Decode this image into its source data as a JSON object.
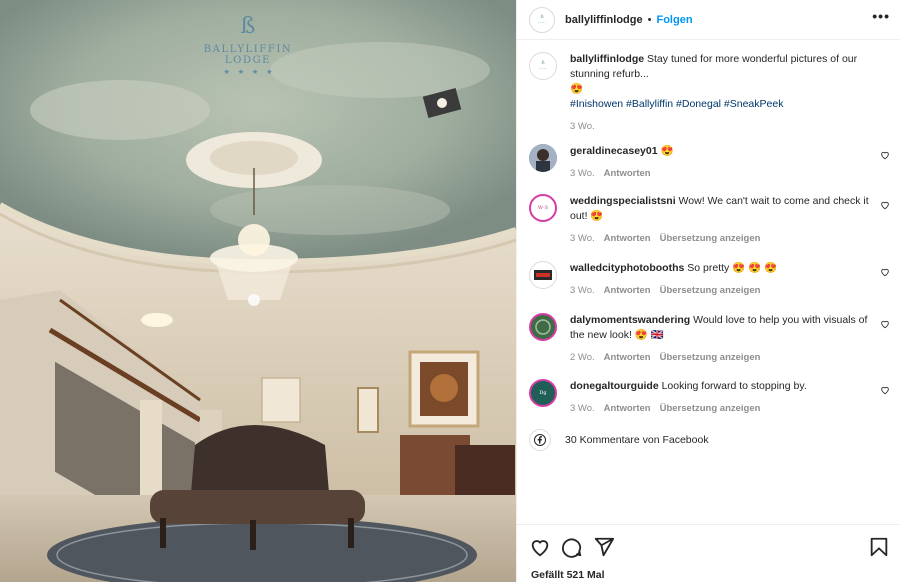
{
  "brand": {
    "mark": "ß",
    "name": "BALLYLIFFIN LODGE",
    "stars": "★★★★"
  },
  "header": {
    "username": "ballyliffinlodge",
    "separator": "•",
    "follow_label": "Folgen",
    "more_label": "•••"
  },
  "caption": {
    "username": "ballyliffinlodge",
    "text": "Stay tuned for more wonderful pictures of our stunning refurb...",
    "emoji": "😍",
    "hashtags": "#Inishowen #Ballyliffin #Donegal #SneakPeek",
    "time": "3 Wo."
  },
  "comments": [
    {
      "username": "geraldinecasey01",
      "text": "😍",
      "time": "3 Wo.",
      "reply": "Antworten",
      "translate": ""
    },
    {
      "username": "weddingspecialistsni",
      "text": "Wow! We can't wait to come and check it out! 😍",
      "time": "3 Wo.",
      "reply": "Antworten",
      "translate": "Übersetzung anzeigen"
    },
    {
      "username": "walledcityphotobooths",
      "text": "So pretty 😍 😍 😍",
      "time": "3 Wo.",
      "reply": "Antworten",
      "translate": "Übersetzung anzeigen"
    },
    {
      "username": "dalymomentswandering",
      "text": "Would love to help you with visuals of the new look! 😍 🇬🇧",
      "time": "2 Wo.",
      "reply": "Antworten",
      "translate": "Übersetzung anzeigen"
    },
    {
      "username": "donegaltourguide",
      "text": "Looking forward to stopping by.",
      "time": "3 Wo.",
      "reply": "Antworten",
      "translate": "Übersetzung anzeigen"
    }
  ],
  "facebook": {
    "label": "30 Kommentare von Facebook",
    "icon": "facebook-icon"
  },
  "footer": {
    "likes": "Gefällt 521 Mal",
    "icons": [
      "heart-icon",
      "comment-icon",
      "share-icon",
      "bookmark-icon"
    ]
  },
  "colors": {
    "accent": "#0095f6",
    "hashtag": "#00376b",
    "muted": "#8e8e8e",
    "text": "#262626"
  }
}
